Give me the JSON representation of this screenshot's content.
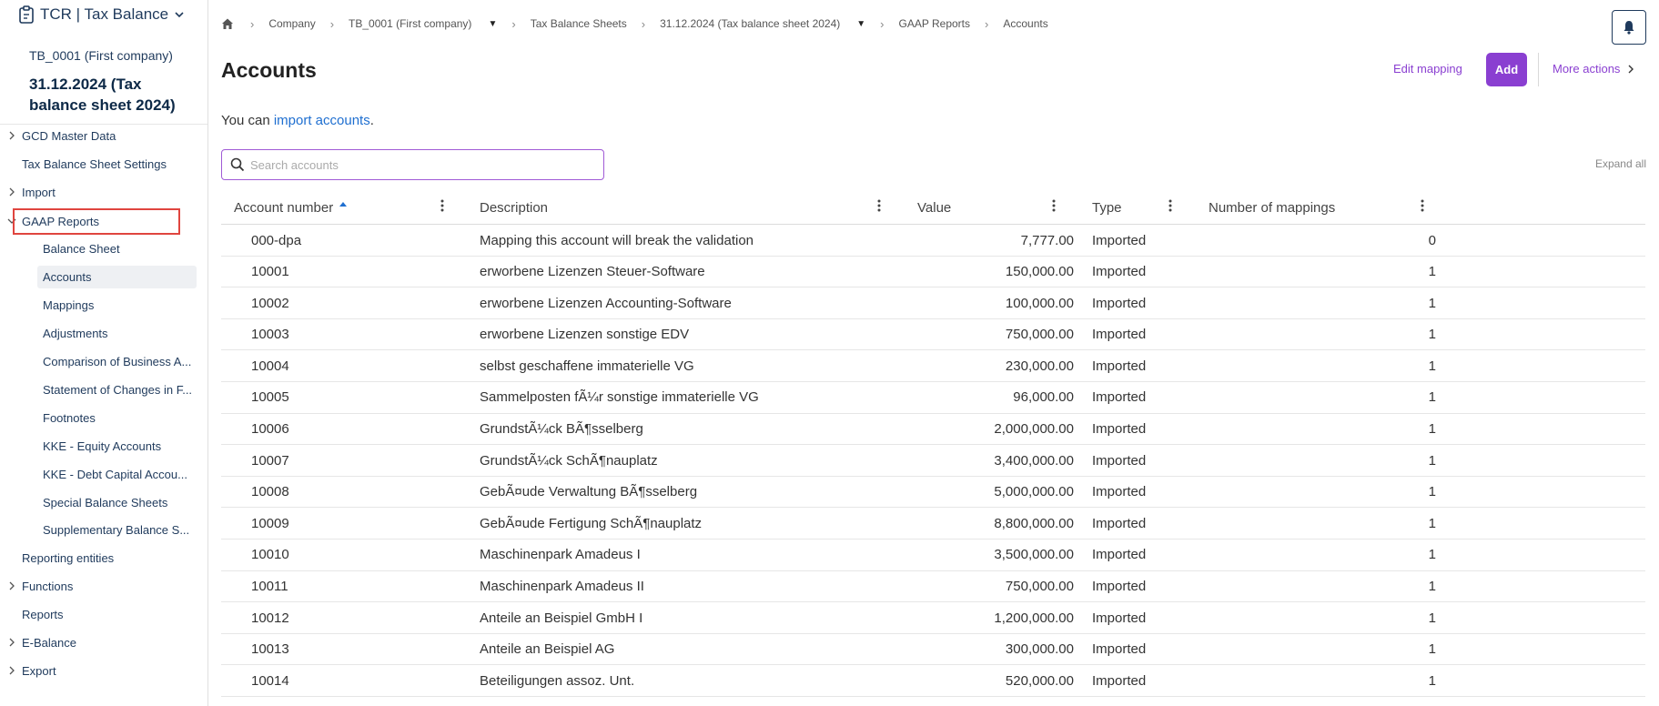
{
  "sidebar": {
    "app_name": "TCR | Tax Balance",
    "company": "TB_0001 (First company)",
    "period_title": "31.12.2024 (Tax balance sheet 2024)",
    "items": [
      {
        "label": "GCD Master Data",
        "chevron": "right"
      },
      {
        "label": "Tax Balance Sheet Settings",
        "chevron": "none"
      },
      {
        "label": "Import",
        "chevron": "right"
      },
      {
        "label": "GAAP Reports",
        "chevron": "down"
      },
      {
        "label": "Reporting entities",
        "chevron": "none"
      },
      {
        "label": "Functions",
        "chevron": "right"
      },
      {
        "label": "Reports",
        "chevron": "none"
      },
      {
        "label": "E-Balance",
        "chevron": "right"
      },
      {
        "label": "Export",
        "chevron": "right"
      }
    ],
    "sub_items": [
      {
        "label": "Balance Sheet",
        "active": false
      },
      {
        "label": "Accounts",
        "active": true
      },
      {
        "label": "Mappings",
        "active": false
      },
      {
        "label": "Adjustments",
        "active": false
      },
      {
        "label": "Comparison of Business A...",
        "active": false
      },
      {
        "label": "Statement of Changes in F...",
        "active": false
      },
      {
        "label": "Footnotes",
        "active": false
      },
      {
        "label": "KKE - Equity Accounts",
        "active": false
      },
      {
        "label": "KKE - Debt Capital Accou...",
        "active": false
      },
      {
        "label": "Special Balance Sheets",
        "active": false
      },
      {
        "label": "Supplementary Balance S...",
        "active": false
      }
    ]
  },
  "breadcrumb": {
    "company": "Company",
    "company_value": "TB_0001 (First company)",
    "sheets": "Tax Balance Sheets",
    "sheet_value": "31.12.2024 (Tax balance sheet 2024)",
    "reports": "GAAP Reports",
    "current": "Accounts"
  },
  "header": {
    "title": "Accounts",
    "edit_mapping": "Edit mapping",
    "add": "Add",
    "more_actions": "More actions"
  },
  "import_line": {
    "prefix": "You can ",
    "link": "import accounts",
    "suffix": "."
  },
  "search": {
    "placeholder": "Search accounts",
    "value": ""
  },
  "expand_all": "Expand all",
  "table": {
    "columns": [
      "Account number",
      "Description",
      "Value",
      "Type",
      "Number of mappings"
    ],
    "sort": {
      "column": "Account number",
      "direction": "asc"
    },
    "rows": [
      [
        "000-dpa",
        "Mapping this account will break the validation",
        "7,777.00",
        "Imported",
        "0"
      ],
      [
        "10001",
        "erworbene Lizenzen Steuer-Software",
        "150,000.00",
        "Imported",
        "1"
      ],
      [
        "10002",
        "erworbene Lizenzen Accounting-Software",
        "100,000.00",
        "Imported",
        "1"
      ],
      [
        "10003",
        "erworbene Lizenzen sonstige EDV",
        "750,000.00",
        "Imported",
        "1"
      ],
      [
        "10004",
        "selbst geschaffene immaterielle VG",
        "230,000.00",
        "Imported",
        "1"
      ],
      [
        "10005",
        "Sammelposten fÃ¼r sonstige immaterielle VG",
        "96,000.00",
        "Imported",
        "1"
      ],
      [
        "10006",
        "GrundstÃ¼ck BÃ¶sselberg",
        "2,000,000.00",
        "Imported",
        "1"
      ],
      [
        "10007",
        "GrundstÃ¼ck SchÃ¶nauplatz",
        "3,400,000.00",
        "Imported",
        "1"
      ],
      [
        "10008",
        "GebÃ¤ude Verwaltung BÃ¶sselberg",
        "5,000,000.00",
        "Imported",
        "1"
      ],
      [
        "10009",
        "GebÃ¤ude Fertigung SchÃ¶nauplatz",
        "8,800,000.00",
        "Imported",
        "1"
      ],
      [
        "10010",
        "Maschinenpark Amadeus I",
        "3,500,000.00",
        "Imported",
        "1"
      ],
      [
        "10011",
        "Maschinenpark Amadeus II",
        "750,000.00",
        "Imported",
        "1"
      ],
      [
        "10012",
        "Anteile an Beispiel GmbH I",
        "1,200,000.00",
        "Imported",
        "1"
      ],
      [
        "10013",
        "Anteile an Beispiel AG",
        "300,000.00",
        "Imported",
        "1"
      ],
      [
        "10014",
        "Beteiligungen assoz. Unt.",
        "520,000.00",
        "Imported",
        "1"
      ]
    ]
  },
  "colors": {
    "accent": "#8a3fd1",
    "link": "#1f6fd0",
    "nav_text": "#1f3a5c",
    "highlight": "#e0453f"
  },
  "icons": [
    "clipboard-icon",
    "chevron-down-icon",
    "chevron-right-icon",
    "home-icon",
    "bell-icon",
    "search-icon",
    "sort-asc-icon",
    "kebab-icon",
    "caret-down-icon"
  ]
}
